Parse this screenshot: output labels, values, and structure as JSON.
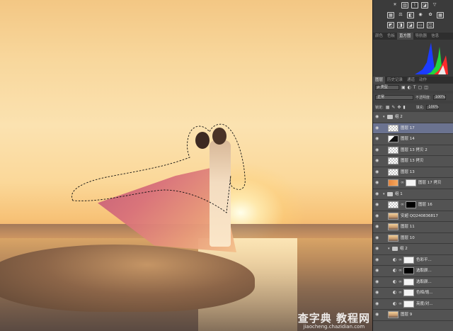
{
  "watermark": {
    "main": "查字典 教程网",
    "sub": "jiaocheng.chazidian.com"
  },
  "histogram_tabs": [
    {
      "label": "颜色",
      "active": false
    },
    {
      "label": "色板",
      "active": false
    },
    {
      "label": "直方图",
      "active": true
    },
    {
      "label": "导航器",
      "active": false
    },
    {
      "label": "信息",
      "active": false
    }
  ],
  "layer_panel_tabs": [
    {
      "label": "图层",
      "active": true
    },
    {
      "label": "历史记录",
      "active": false
    },
    {
      "label": "通道",
      "active": false
    },
    {
      "label": "动作",
      "active": false
    }
  ],
  "layer_controls": {
    "kind_filter": "ρ 类型",
    "blend_mode": "正常",
    "opacity_label": "不透明度:",
    "opacity_value": "100%",
    "lock_label": "锁定:",
    "fill_label": "填充:",
    "fill_value": "100%"
  },
  "layers": [
    {
      "name": "组 2",
      "type": "group",
      "expanded": true,
      "indent": 0,
      "visible": true,
      "selected": false
    },
    {
      "name": "图层 17",
      "type": "layer",
      "thumb": "check",
      "indent": 1,
      "visible": true,
      "selected": true
    },
    {
      "name": "图层 14",
      "type": "layer",
      "thumb": "dark",
      "indent": 1,
      "visible": true,
      "selected": false
    },
    {
      "name": "图层 13 拷贝 2",
      "type": "layer",
      "thumb": "check",
      "indent": 1,
      "visible": true,
      "selected": false
    },
    {
      "name": "图层 13 拷贝",
      "type": "layer",
      "thumb": "check",
      "indent": 1,
      "visible": true,
      "selected": false
    },
    {
      "name": "图层 13",
      "type": "layer",
      "thumb": "check",
      "indent": 1,
      "visible": true,
      "selected": false
    },
    {
      "name": "图层 17 拷贝",
      "type": "masked",
      "thumb": "orange",
      "mask": "white",
      "indent": 1,
      "visible": true,
      "selected": false
    },
    {
      "name": "组 1",
      "type": "group",
      "expanded": true,
      "indent": 0,
      "visible": true,
      "selected": false
    },
    {
      "name": "图层 16",
      "type": "masked",
      "thumb": "check",
      "mask": "black",
      "indent": 1,
      "visible": true,
      "selected": false
    },
    {
      "name": "安超 QQ240836817",
      "type": "layer",
      "thumb": "photo",
      "indent": 1,
      "visible": true,
      "selected": false
    },
    {
      "name": "图层 11",
      "type": "layer",
      "thumb": "photo",
      "indent": 1,
      "visible": true,
      "selected": false
    },
    {
      "name": "图层 10",
      "type": "layer",
      "thumb": "photo",
      "indent": 1,
      "visible": true,
      "selected": false
    },
    {
      "name": "组 2",
      "type": "group",
      "expanded": true,
      "indent": 1,
      "visible": true,
      "selected": false
    },
    {
      "name": "色彩平...",
      "type": "adjust",
      "mask": "white",
      "indent": 2,
      "visible": true,
      "selected": false
    },
    {
      "name": "选取颜...",
      "type": "adjust",
      "mask": "black",
      "indent": 2,
      "visible": true,
      "selected": false
    },
    {
      "name": "选取颜...",
      "type": "adjust",
      "mask": "white",
      "indent": 2,
      "visible": true,
      "selected": false
    },
    {
      "name": "色相/饱...",
      "type": "adjust",
      "mask": "white",
      "indent": 2,
      "visible": true,
      "selected": false
    },
    {
      "name": "亮度/对...",
      "type": "adjust",
      "mask": "white",
      "indent": 2,
      "visible": true,
      "selected": false
    },
    {
      "name": "图层 9",
      "type": "layer",
      "thumb": "photo",
      "indent": 1,
      "visible": true,
      "selected": false
    }
  ],
  "colors": {
    "panel": "#404040",
    "layer_row": "#535353",
    "selected_row": "#6b7390",
    "histogram_blue": "#1c3cff",
    "histogram_green": "#22d43c",
    "histogram_red": "#ff2a2a"
  }
}
